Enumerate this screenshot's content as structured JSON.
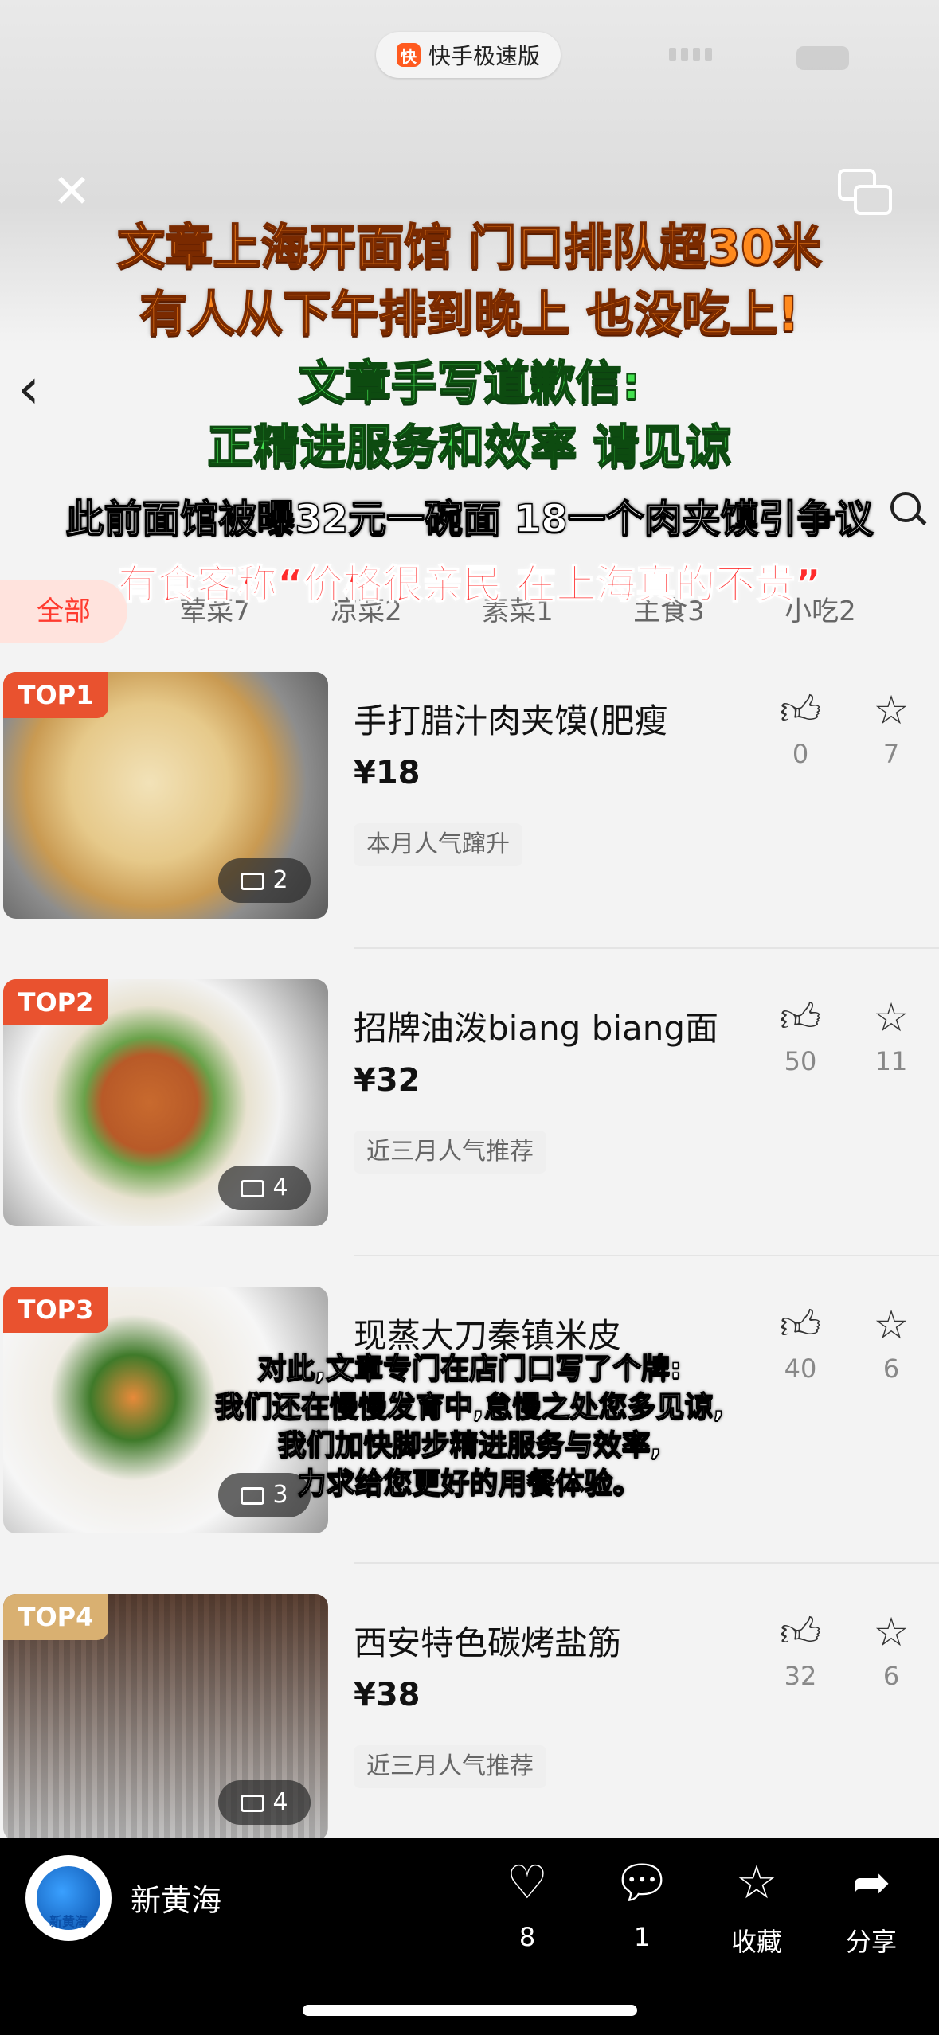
{
  "app_pill": {
    "label": "快手极速版"
  },
  "captions": {
    "line1": "文章上海开面馆 门口排队超30米",
    "line2": "有人从下午排到晚上 也没吃上!",
    "line3": "文章手写道歉信:",
    "line4": "正精进服务和效率 请见谅",
    "line5": "此前面馆被曝32元一碗面 18一个肉夹馍引争议",
    "line6": "有食客称“价格很亲民 在上海真的不贵”",
    "sub1": "对此,文章专门在店门口写了个牌:",
    "sub2": "我们还在慢慢发育中,怠慢之处您多见谅,",
    "sub3": "我们加快脚步精进服务与效率,",
    "sub4": "力求给您更好的用餐体验。"
  },
  "tabs": [
    {
      "label": "全部"
    },
    {
      "label": "荤菜7"
    },
    {
      "label": "凉菜2"
    },
    {
      "label": "素菜1"
    },
    {
      "label": "主食3"
    },
    {
      "label": "小吃2"
    }
  ],
  "items": [
    {
      "rank": "TOP1",
      "name": "手打腊汁肉夹馍(肥瘦",
      "price": "¥18",
      "tag": "本月人气蹿升",
      "likes": "0",
      "stars": "7",
      "images": "2",
      "badge_color": "#e9522f"
    },
    {
      "rank": "TOP2",
      "name": "招牌油泼biang biang面",
      "price": "¥32",
      "tag": "近三月人气推荐",
      "likes": "50",
      "stars": "11",
      "images": "4",
      "badge_color": "#e9522f"
    },
    {
      "rank": "TOP3",
      "name": "现蒸大刀秦镇米皮",
      "price": "",
      "tag": "",
      "likes": "40",
      "stars": "6",
      "images": "3",
      "badge_color": "#e9522f"
    },
    {
      "rank": "TOP4",
      "name": "西安特色碳烤盐筋",
      "price": "¥38",
      "tag": "近三月人气推荐",
      "likes": "32",
      "stars": "6",
      "images": "4",
      "badge_color": "#d9b071"
    }
  ],
  "bottom": {
    "account": "新黄海",
    "avatar_text": "新黄海",
    "like_count": "8",
    "comment_count": "1",
    "collect_label": "收藏",
    "share_label": "分享"
  },
  "icons": {
    "like": "heart-icon",
    "comment": "comment-bubble-icon",
    "collect": "star-icon",
    "share": "share-arrow-icon",
    "item_like": "thumbs-up-icon",
    "item_star": "star-outline-icon"
  }
}
